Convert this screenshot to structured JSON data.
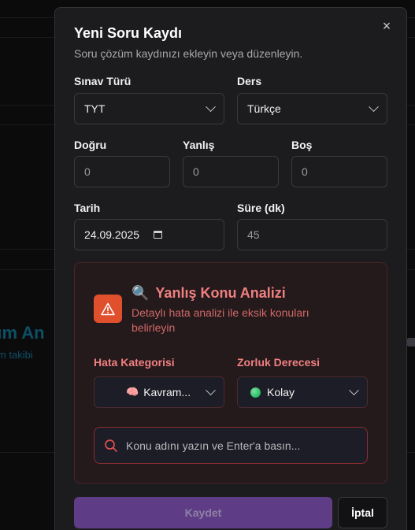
{
  "background": {
    "heading_fragment": "züm An",
    "sub_fragment": "m takibi"
  },
  "modal": {
    "title": "Yeni Soru Kaydı",
    "subtitle": "Soru çözüm kaydınızı ekleyin veya düzenleyin.",
    "close_icon": "×"
  },
  "form": {
    "exam_type": {
      "label": "Sınav Türü",
      "value": "TYT"
    },
    "course": {
      "label": "Ders",
      "value": "Türkçe"
    },
    "correct": {
      "label": "Doğru",
      "value": "0"
    },
    "wrong": {
      "label": "Yanlış",
      "value": "0"
    },
    "blank": {
      "label": "Boş",
      "value": "0"
    },
    "date": {
      "label": "Tarih",
      "value": "24.09.2025"
    },
    "duration": {
      "label": "Süre (dk)",
      "value": "45"
    }
  },
  "analysis": {
    "title_icon": "🔍",
    "title": "Yanlış Konu Analizi",
    "description": "Detaylı hata analizi ile eksik konuları belirleyin",
    "error_category": {
      "label": "Hata Kategorisi",
      "icon": "🧠",
      "value": "Kavram..."
    },
    "difficulty": {
      "label": "Zorluk Derecesi",
      "value": "Kolay",
      "dot_color": "#2fc26b"
    },
    "topic_placeholder": "Konu adını yazın ve Enter'a basın..."
  },
  "actions": {
    "save_label": "Kaydet",
    "cancel_label": "İptal"
  },
  "colors": {
    "accent_purple": "#5e3d86",
    "warning_orange": "#e0502c",
    "analysis_red": "#f08080"
  }
}
